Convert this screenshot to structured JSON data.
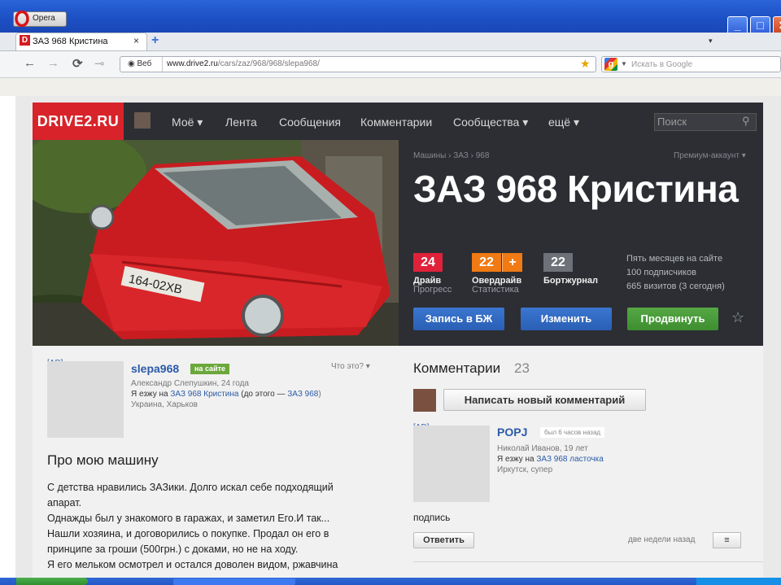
{
  "browser": {
    "menu_label": "Opera",
    "tab_title": "ЗАЗ 968 Кристина",
    "tab_close": "×",
    "new_tab": "+",
    "tab_menu": "▾",
    "window_buttons": {
      "minimize": "_",
      "maximize": "□",
      "close": "✕"
    },
    "address": {
      "mode_label": "Веб",
      "url_host": "www.drive2.ru",
      "url_path": "/cars/zaz/968/968/slepa968/"
    },
    "search": {
      "engine_icon": "g",
      "placeholder": "Искать в Google"
    },
    "nav": {
      "back": "←",
      "forward": "→",
      "reload": "⟳",
      "key": "⊸"
    }
  },
  "site": {
    "logo": "DRIVE2.RU",
    "nav": [
      {
        "label": "Моё ▾"
      },
      {
        "label": "Лента"
      },
      {
        "label": "Сообщения"
      },
      {
        "label": "Комментарии"
      },
      {
        "label": "Сообщества ▾"
      },
      {
        "label": "ещё ▾"
      }
    ],
    "search_placeholder": "Поиск"
  },
  "car": {
    "breadcrumb": "Машины › ЗАЗ › 968",
    "premium": "Премиум-аккаунт ▾",
    "title": "ЗАЗ 968 Кристина",
    "stats": [
      {
        "value": "24",
        "label": "Драйв",
        "sub": "Прогресс",
        "color": "#e0213a"
      },
      {
        "value": "22",
        "plus": "+",
        "label": "Овердрайв",
        "sub": "Статистика",
        "color": "#f07a13"
      },
      {
        "value": "22",
        "label": "Бортжурнал",
        "sub": "",
        "color": "#6e7278"
      }
    ],
    "site_info": [
      "Пять месяцев на сайте",
      "100 подписчиков",
      "665 визитов (3 сегодня)"
    ],
    "buttons": {
      "bj": "Запись в БЖ",
      "edit": "Изменить",
      "promote": "Продвинуть"
    },
    "fav_star": "☆"
  },
  "author": {
    "ad_label": "[AD]",
    "name": "slepa968",
    "online": "на сайте",
    "whatsthis": "Что это? ▾",
    "fullname": "Александр Слепушкин, 24 года",
    "drives_prefix": "Я езжу на",
    "drives_car": "ЗАЗ 968 Кристина",
    "drives_before": "(до этого —",
    "drives_before_car": "ЗАЗ 968",
    "drives_before_close": ")",
    "location": "Украина, Харьков"
  },
  "about": {
    "title": "Про мою машину",
    "text": [
      "С детства нравились ЗАЗики. Долго искал себе подходящий",
      "апарат.",
      "Однажды был у знакомого в гаражах, и заметил Его.И так...",
      "Нашли хозяина, и договорились о покупке. Продал он его в",
      "принципе за гроши (500грн.) с доками, но не на ходу.",
      "Я его мельком осмотрел и остался доволен видом, ржавчина"
    ]
  },
  "comments": {
    "title": "Комментарии",
    "count": "23",
    "write_label": "Написать новый комментарий",
    "ad_label": "[AD]",
    "items": [
      {
        "author": "POPJ",
        "status": "был 6 часов назад",
        "fullname": "Николай Иванов, 19 лет",
        "drives_prefix": "Я езжу на",
        "car": "ЗАЗ 968 ласточка",
        "location": "Иркутск, супер",
        "text": "подпись",
        "reply_label": "Ответить",
        "date": "две недели назад",
        "menu_icon": "≡"
      }
    ]
  }
}
